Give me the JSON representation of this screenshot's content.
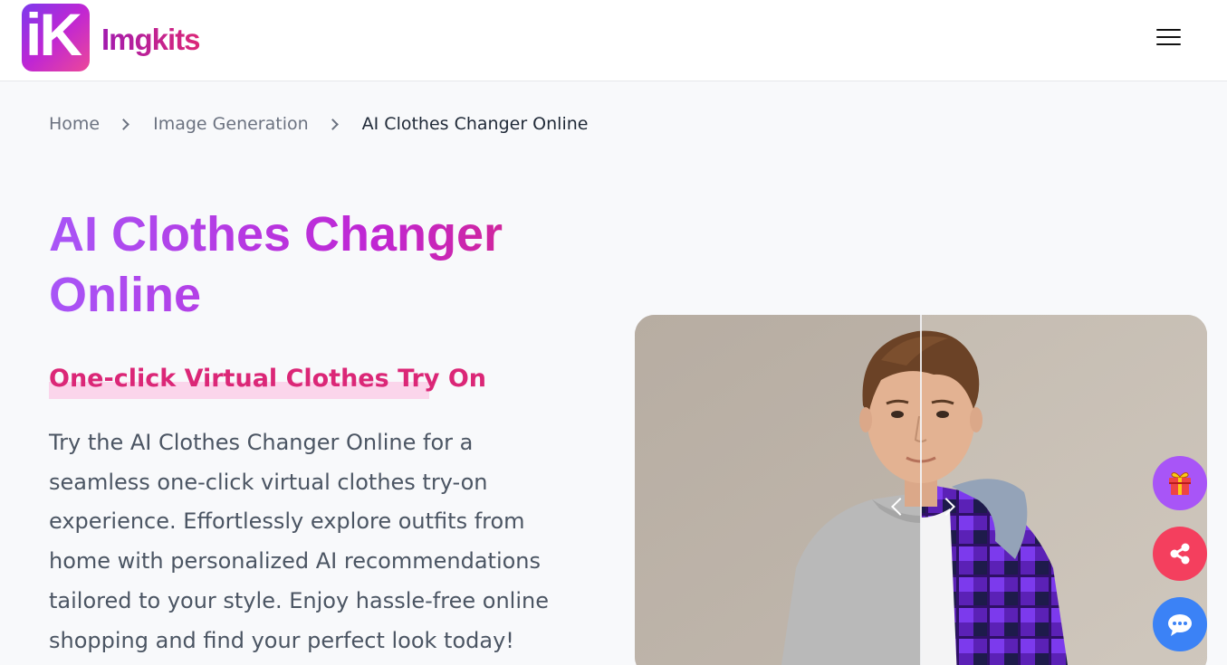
{
  "header": {
    "brand_name": "Imgkits",
    "logo_letters": "iK",
    "menu_icon": "hamburger-menu-icon"
  },
  "breadcrumb": {
    "items": [
      "Home",
      "Image Generation",
      "AI Clothes Changer Online"
    ]
  },
  "hero": {
    "title": "AI Clothes Changer Online",
    "subtitle": "One-click Virtual Clothes Try On",
    "description": "Try the AI Clothes Changer Online for a seamless one-click virtual clothes try-on experience. Effortlessly explore outfits from home with personalized AI recommendations tailored to your style. Enjoy hassle-free online shopping and find your perfect look today!"
  },
  "comparison": {
    "left_arrow_icon": "chevron-left-icon",
    "right_arrow_icon": "chevron-right-icon"
  },
  "floating_actions": [
    {
      "name": "gift-button",
      "icon": "gift-icon",
      "color": "#a855f7"
    },
    {
      "name": "share-button",
      "icon": "share-icon",
      "color": "#f43f5e"
    },
    {
      "name": "chat-button",
      "icon": "chat-icon",
      "color": "#3b82f6"
    }
  ],
  "colors": {
    "brand_gradient_start": "#a855f7",
    "brand_gradient_end": "#db2777",
    "subtitle_color": "#db2777",
    "subtitle_highlight": "#fbcfe8"
  }
}
